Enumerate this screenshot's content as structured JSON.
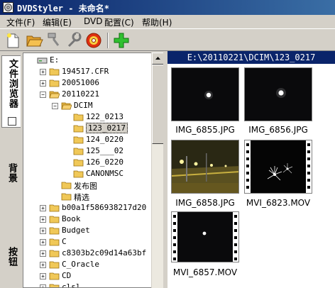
{
  "window": {
    "title": "DVDStyler - 未命名*"
  },
  "menu": [
    {
      "label": "文件(F)"
    },
    {
      "label": "编辑(E)"
    },
    {
      "label": "DVD"
    },
    {
      "label": "配置(C)"
    },
    {
      "label": "帮助(H)"
    }
  ],
  "toolbar": {
    "buttons": [
      {
        "icon": "new-file-icon"
      },
      {
        "icon": "open-folder-icon"
      },
      {
        "icon": "save-icon"
      },
      {
        "icon": "settings-icon"
      },
      {
        "icon": "burn-disc-icon"
      },
      {
        "icon": "add-icon"
      }
    ]
  },
  "vertical_tabs": [
    {
      "label": "文件浏览器",
      "active": true
    },
    {
      "label": "背景",
      "active": false
    },
    {
      "label": "按钮",
      "active": false
    }
  ],
  "tree": {
    "items": [
      {
        "label": "E:",
        "depth": 0,
        "expander": "none",
        "kind": "drive"
      },
      {
        "label": "194517.CFR",
        "depth": 1,
        "expander": "+",
        "kind": "folder"
      },
      {
        "label": "20051006",
        "depth": 1,
        "expander": "+",
        "kind": "folder"
      },
      {
        "label": "20110221",
        "depth": 1,
        "expander": "-",
        "kind": "folder-open"
      },
      {
        "label": "DCIM",
        "depth": 2,
        "expander": "-",
        "kind": "folder-open"
      },
      {
        "label": "122_0213",
        "depth": 3,
        "expander": "none",
        "kind": "folder"
      },
      {
        "label": "123_0217",
        "depth": 3,
        "expander": "none",
        "kind": "folder",
        "selected": true
      },
      {
        "label": "124_0220",
        "depth": 3,
        "expander": "none",
        "kind": "folder"
      },
      {
        "label": "125___02",
        "depth": 3,
        "expander": "none",
        "kind": "folder"
      },
      {
        "label": "126_0220",
        "depth": 3,
        "expander": "none",
        "kind": "folder"
      },
      {
        "label": "CANONMSC",
        "depth": 3,
        "expander": "none",
        "kind": "folder"
      },
      {
        "label": "发布图",
        "depth": 2,
        "expander": "none",
        "kind": "folder"
      },
      {
        "label": "精选",
        "depth": 2,
        "expander": "none",
        "kind": "folder"
      },
      {
        "label": "b00a1f586938217d20",
        "depth": 1,
        "expander": "+",
        "kind": "folder"
      },
      {
        "label": "Book",
        "depth": 1,
        "expander": "+",
        "kind": "folder"
      },
      {
        "label": "Budget",
        "depth": 1,
        "expander": "+",
        "kind": "folder"
      },
      {
        "label": "C",
        "depth": 1,
        "expander": "+",
        "kind": "folder"
      },
      {
        "label": "c8303b2c09d14a63bf",
        "depth": 1,
        "expander": "+",
        "kind": "folder"
      },
      {
        "label": "C_Oracle",
        "depth": 1,
        "expander": "+",
        "kind": "folder"
      },
      {
        "label": "CD",
        "depth": 1,
        "expander": "+",
        "kind": "folder"
      },
      {
        "label": "clsl",
        "depth": 1,
        "expander": "+",
        "kind": "folder"
      }
    ]
  },
  "path": "E:\\20110221\\DCIM\\123_0217",
  "thumbnails": [
    {
      "name": "IMG_6855.JPG",
      "kind": "moon"
    },
    {
      "name": "IMG_6856.JPG",
      "kind": "moon"
    },
    {
      "name": "IMG_6858.JPG",
      "kind": "street"
    },
    {
      "name": "MVI_6823.MOV",
      "kind": "fireworks-video"
    },
    {
      "name": "MVI_6857.MOV",
      "kind": "moon-video"
    }
  ],
  "colors": {
    "titlebar": "#0a246a",
    "selection_bg": "#0a246a",
    "window_bg": "#d4d0c8",
    "folder": "#e8c860"
  }
}
